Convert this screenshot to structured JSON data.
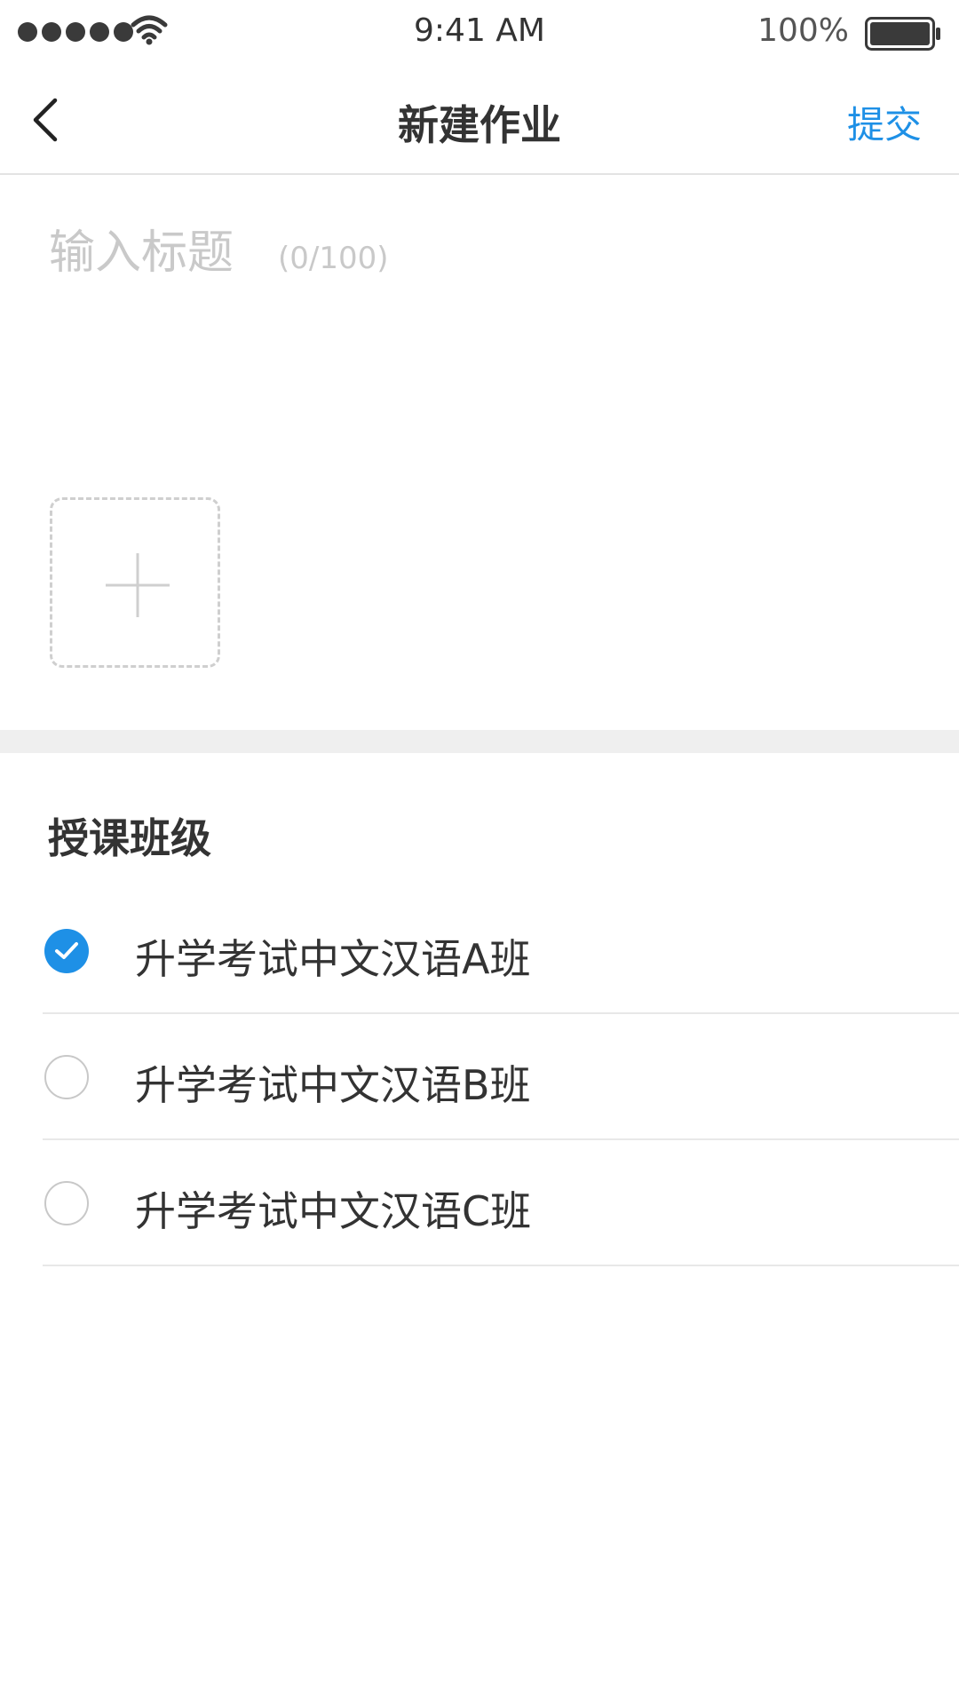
{
  "status_bar": {
    "time": "9:41 AM",
    "battery_percent": "100%",
    "signal_icon": "signal-dots-icon",
    "wifi_icon": "wifi-icon",
    "battery_icon": "battery-icon"
  },
  "nav": {
    "back_icon": "chevron-left-icon",
    "title": "新建作业",
    "submit_label": "提交",
    "submit_color": "#1e90e6"
  },
  "title_input": {
    "value": "",
    "placeholder": "输入标题",
    "counter": "(0/100)"
  },
  "add_image": {
    "icon": "plus-icon"
  },
  "class_section": {
    "heading": "授课班级",
    "classes": [
      {
        "label": "升学考试中文汉语A班",
        "selected": true
      },
      {
        "label": "升学考试中文汉语B班",
        "selected": false
      },
      {
        "label": "升学考试中文汉语C班",
        "selected": false
      }
    ]
  },
  "colors": {
    "accent": "#1e90e6",
    "text": "#333333",
    "placeholder": "#c9c9c9",
    "separator": "#efefef"
  }
}
